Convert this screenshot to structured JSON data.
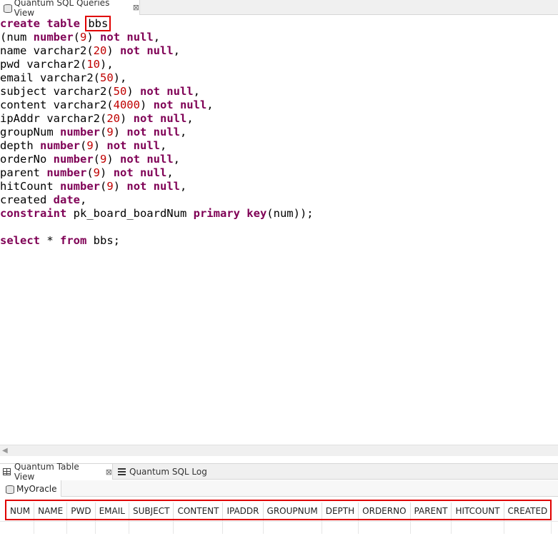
{
  "editor_tab": {
    "title": "Quantum SQL Queries View",
    "close": "⊠"
  },
  "editor": {
    "lines": [
      [
        {
          "t": "create table",
          "c": "kw"
        },
        {
          "t": " "
        },
        {
          "t": "bbs",
          "c": "hl"
        }
      ],
      [
        {
          "t": "(num "
        },
        {
          "t": "number",
          "c": "kw"
        },
        {
          "t": "("
        },
        {
          "t": "9",
          "c": "num"
        },
        {
          "t": ") "
        },
        {
          "t": "not null",
          "c": "kw"
        },
        {
          "t": ","
        }
      ],
      [
        {
          "t": "name varchar2("
        },
        {
          "t": "20",
          "c": "num"
        },
        {
          "t": ") "
        },
        {
          "t": "not null",
          "c": "kw"
        },
        {
          "t": ","
        }
      ],
      [
        {
          "t": "pwd varchar2("
        },
        {
          "t": "10",
          "c": "num"
        },
        {
          "t": "),"
        }
      ],
      [
        {
          "t": "email varchar2("
        },
        {
          "t": "50",
          "c": "num"
        },
        {
          "t": "),"
        }
      ],
      [
        {
          "t": "subject varchar2("
        },
        {
          "t": "50",
          "c": "num"
        },
        {
          "t": ") "
        },
        {
          "t": "not null",
          "c": "kw"
        },
        {
          "t": ","
        }
      ],
      [
        {
          "t": "content varchar2("
        },
        {
          "t": "4000",
          "c": "num"
        },
        {
          "t": ") "
        },
        {
          "t": "not null",
          "c": "kw"
        },
        {
          "t": ","
        }
      ],
      [
        {
          "t": "ipAddr varchar2("
        },
        {
          "t": "20",
          "c": "num"
        },
        {
          "t": ") "
        },
        {
          "t": "not null",
          "c": "kw"
        },
        {
          "t": ","
        }
      ],
      [
        {
          "t": "groupNum "
        },
        {
          "t": "number",
          "c": "kw"
        },
        {
          "t": "("
        },
        {
          "t": "9",
          "c": "num"
        },
        {
          "t": ") "
        },
        {
          "t": "not null",
          "c": "kw"
        },
        {
          "t": ","
        }
      ],
      [
        {
          "t": "depth "
        },
        {
          "t": "number",
          "c": "kw"
        },
        {
          "t": "("
        },
        {
          "t": "9",
          "c": "num"
        },
        {
          "t": ") "
        },
        {
          "t": "not null",
          "c": "kw"
        },
        {
          "t": ","
        }
      ],
      [
        {
          "t": "orderNo "
        },
        {
          "t": "number",
          "c": "kw"
        },
        {
          "t": "("
        },
        {
          "t": "9",
          "c": "num"
        },
        {
          "t": ") "
        },
        {
          "t": "not null",
          "c": "kw"
        },
        {
          "t": ","
        }
      ],
      [
        {
          "t": "parent "
        },
        {
          "t": "number",
          "c": "kw"
        },
        {
          "t": "("
        },
        {
          "t": "9",
          "c": "num"
        },
        {
          "t": ") "
        },
        {
          "t": "not null",
          "c": "kw"
        },
        {
          "t": ","
        }
      ],
      [
        {
          "t": "hitCount "
        },
        {
          "t": "number",
          "c": "kw"
        },
        {
          "t": "("
        },
        {
          "t": "9",
          "c": "num"
        },
        {
          "t": ") "
        },
        {
          "t": "not null",
          "c": "kw"
        },
        {
          "t": ","
        }
      ],
      [
        {
          "t": "created "
        },
        {
          "t": "date",
          "c": "kw"
        },
        {
          "t": ","
        }
      ],
      [
        {
          "t": "constraint",
          "c": "kw"
        },
        {
          "t": " pk_board_boardNum "
        },
        {
          "t": "primary key",
          "c": "kw"
        },
        {
          "t": "(num));"
        }
      ],
      [],
      [
        {
          "t": "select",
          "c": "kw"
        },
        {
          "t": " * "
        },
        {
          "t": "from",
          "c": "kw"
        },
        {
          "t": " bbs;"
        }
      ]
    ]
  },
  "bottom_tabs": {
    "table_view": "Quantum Table View",
    "table_view_close": "⊠",
    "sql_log": "Quantum SQL Log"
  },
  "connection_tab": {
    "label": "MyOracle"
  },
  "results": {
    "columns": [
      "NUM",
      "NAME",
      "PWD",
      "EMAIL",
      "SUBJECT",
      "CONTENT",
      "IPADDR",
      "GROUPNUM",
      "DEPTH",
      "ORDERNO",
      "PARENT",
      "HITCOUNT",
      "CREATED"
    ]
  },
  "colors": {
    "keyword": "#7f0055",
    "number": "#c00000",
    "highlight_box": "#e00000"
  },
  "icons": {
    "editor_tab": "database-icon",
    "table_view": "table-grid-icon",
    "sql_log": "log-list-icon",
    "connection": "database-icon"
  }
}
